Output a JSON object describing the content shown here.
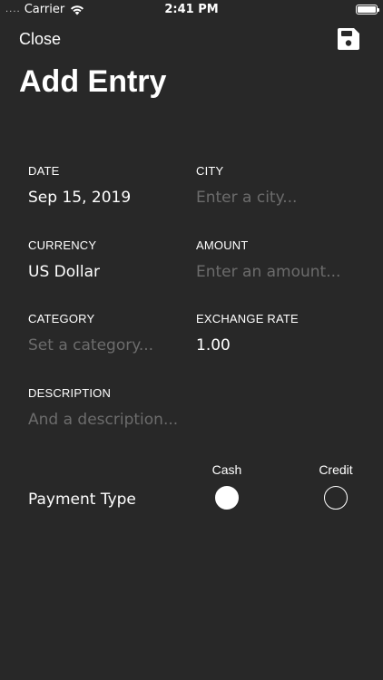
{
  "status_bar": {
    "signal": "....",
    "carrier": "Carrier",
    "time": "2:41 PM"
  },
  "nav": {
    "close_label": "Close",
    "save_icon": "floppy-disk-icon"
  },
  "title": "Add Entry",
  "form": {
    "date": {
      "label": "DATE",
      "value": "Sep 15, 2019"
    },
    "city": {
      "label": "CITY",
      "value": "",
      "placeholder": "Enter a city..."
    },
    "currency": {
      "label": "CURRENCY",
      "value": "US Dollar"
    },
    "amount": {
      "label": "AMOUNT",
      "value": "",
      "placeholder": "Enter an amount..."
    },
    "category": {
      "label": "CATEGORY",
      "value": "",
      "placeholder": "Set a category..."
    },
    "exchange_rate": {
      "label": "EXCHANGE RATE",
      "value": "1.00"
    },
    "description": {
      "label": "DESCRIPTION",
      "value": "",
      "placeholder": "And a description..."
    }
  },
  "payment": {
    "label": "Payment Type",
    "options": [
      {
        "label": "Cash",
        "selected": true
      },
      {
        "label": "Credit",
        "selected": false
      }
    ]
  },
  "colors": {
    "background": "#282828",
    "text": "#ffffff",
    "placeholder": "#6c6c6c"
  }
}
